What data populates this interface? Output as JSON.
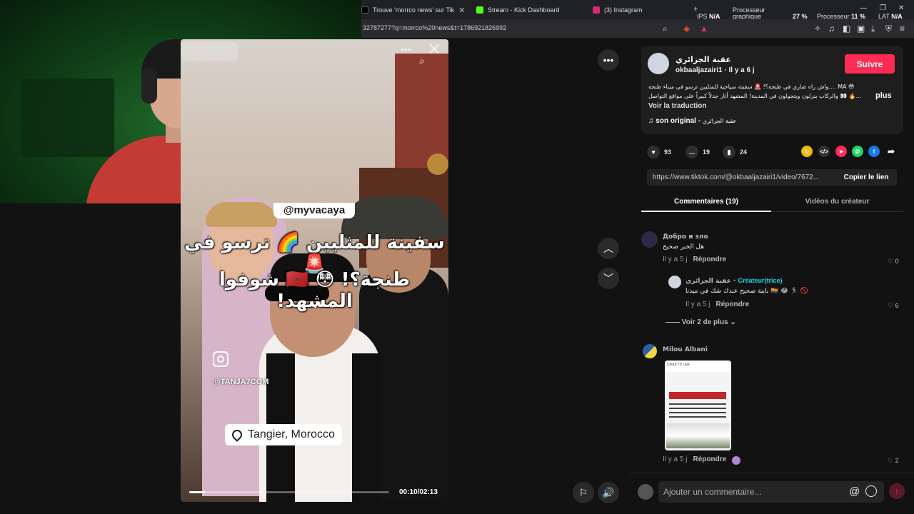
{
  "tabs": [
    {
      "label": "Trouve 'morrco news' sur Tik",
      "color": "#000000"
    },
    {
      "label": "Stream - Kick Dashboard",
      "color": "#53fc18"
    },
    {
      "label": "(3) Instagram",
      "color": "#d62976"
    }
  ],
  "perf": {
    "ips_label": "IPS",
    "ips_value": "N/A",
    "gpu_label": "Processeur graphique",
    "gpu_value": "27 %",
    "cpu_label": "Processeur",
    "cpu_value": "11 %",
    "lat_label": "LAT",
    "lat_value": "N/A"
  },
  "address": {
    "url": "32787277?q=morrco%20news&t=1786921826992"
  },
  "video": {
    "follow_label": "llow",
    "tag": "@myvacaya",
    "caption_line1": "سفينة للمثليين 🌈 ترسو في 🚨",
    "caption_line2": "طنجة؟! 😳 🇲🇦 شوفوا المشهد!",
    "instagram_handle": "@TANJA7COM",
    "location": "Tangier, Morocco",
    "time": "00:10/02:13",
    "progress": 0.08
  },
  "post": {
    "author": "عقبة الجزائري",
    "author_handle": "okbaaljazairi1",
    "posted": "Il y a 6 j",
    "follow_label": "Suivre",
    "desc_line1": "واش راه صاري في طنجة؟! 🚨 سفينة سياحية للمثليين ترسو في ميناء طنجة.... MA 😳",
    "desc_line2": "والركاب ينزلون ويتجولون في المدينة! المشهد أثار جدلاً كبيراً على مواقع التواصل 👀 🔥...",
    "more_label": "plus",
    "translate_label": "Voir la traduction",
    "music_label": "son original",
    "music_author": "عقبة الجزائري",
    "likes": "93",
    "comments_count": "19",
    "saves": "24",
    "link": "https://www.tiktok.com/@okbaaljazairi1/video/7672...",
    "copy_label": "Copier le lien",
    "tab_comments": "Commentaires (19)",
    "tab_creator": "Vidéos du créateur"
  },
  "comments": [
    {
      "name": "Добро и зло",
      "text": "هل الخبر صحيح",
      "time": "Il y a 5 j",
      "reply": "Répondre",
      "likes": "0"
    },
    {
      "name": "عقبة الجزائري",
      "badge": "Créateur(trice)",
      "text": "باينة صحيح عندك شك في ميدنا 🏳️‍🌈 😂 🏃‍♂️ 🚫",
      "time": "Il y a 5 j",
      "reply": "Répondre",
      "likes": "6"
    },
    {
      "name": "Milou Albani",
      "image_caption": "Chouf TV Live",
      "time": "Il y a 5 j",
      "reply": "Répondre",
      "likes": "2"
    }
  ],
  "more_replies": "Voir 2 de plus",
  "comment_input": {
    "placeholder": "Ajouter un commentaire..."
  }
}
